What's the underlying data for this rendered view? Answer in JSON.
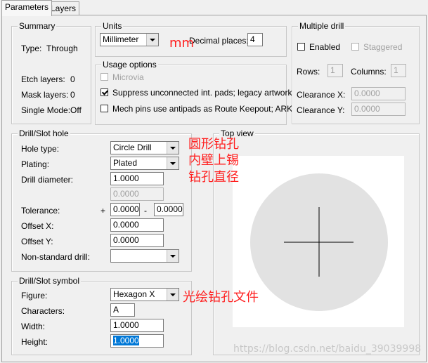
{
  "tabs": [
    "Parameters",
    "Layers"
  ],
  "summary": {
    "title": "Summary",
    "type_label": "Type:",
    "type_value": "Through",
    "etch_label": "Etch layers:",
    "etch_value": "0",
    "mask_label": "Mask layers:",
    "mask_value": "0",
    "single_label": "Single Mode:",
    "single_value": "Off"
  },
  "units": {
    "title": "Units",
    "unit_value": "Millimeter",
    "decimal_label": "Decimal places:",
    "decimal_value": "4"
  },
  "usage": {
    "title": "Usage options",
    "microvia": "Microvia",
    "suppress": "Suppress unconnected int. pads; legacy artwork",
    "mech": "Mech pins use antipads as Route Keepout; ARK",
    "suppress_checked": true
  },
  "multiple": {
    "title": "Multiple drill",
    "enabled": "Enabled",
    "staggered": "Staggered",
    "rows_label": "Rows:",
    "rows_value": "1",
    "cols_label": "Columns:",
    "cols_value": "1",
    "clearx_label": "Clearance X:",
    "clearx_value": "0.0000",
    "cleary_label": "Clearance Y:",
    "cleary_value": "0.0000"
  },
  "drill": {
    "title": "Drill/Slot hole",
    "holetype_label": "Hole type:",
    "holetype_value": "Circle Drill",
    "plating_label": "Plating:",
    "plating_value": "Plated",
    "diameter_label": "Drill diameter:",
    "diameter_value": "1.0000",
    "diameter2_value": "0.0000",
    "tol_label": "Tolerance:",
    "tol_plus": "+",
    "tol_plus_value": "0.0000",
    "tol_minus": "-",
    "tol_minus_value": "0.0000",
    "offx_label": "Offset X:",
    "offx_value": "0.0000",
    "offy_label": "Offset Y:",
    "offy_value": "0.0000",
    "nonstd_label": "Non-standard drill:",
    "nonstd_value": ""
  },
  "symbol": {
    "title": "Drill/Slot symbol",
    "figure_label": "Figure:",
    "figure_value": "Hexagon X",
    "chars_label": "Characters:",
    "chars_value": "A",
    "width_label": "Width:",
    "width_value": "1.0000",
    "height_label": "Height:",
    "height_value": "1.0000"
  },
  "topview": {
    "title": "Top view"
  },
  "annotations": {
    "mm": "mm",
    "hole": "圆形钻孔",
    "plated": "内壁上锡",
    "diameter": "钻孔直径",
    "figure": "光绘钻孔文件"
  },
  "watermark": "https://blog.csdn.net/baidu_39039998",
  "colors": {
    "annotation": "#ff2020",
    "selection": "#0078d7",
    "preview_disc": "#e2e2e2"
  }
}
